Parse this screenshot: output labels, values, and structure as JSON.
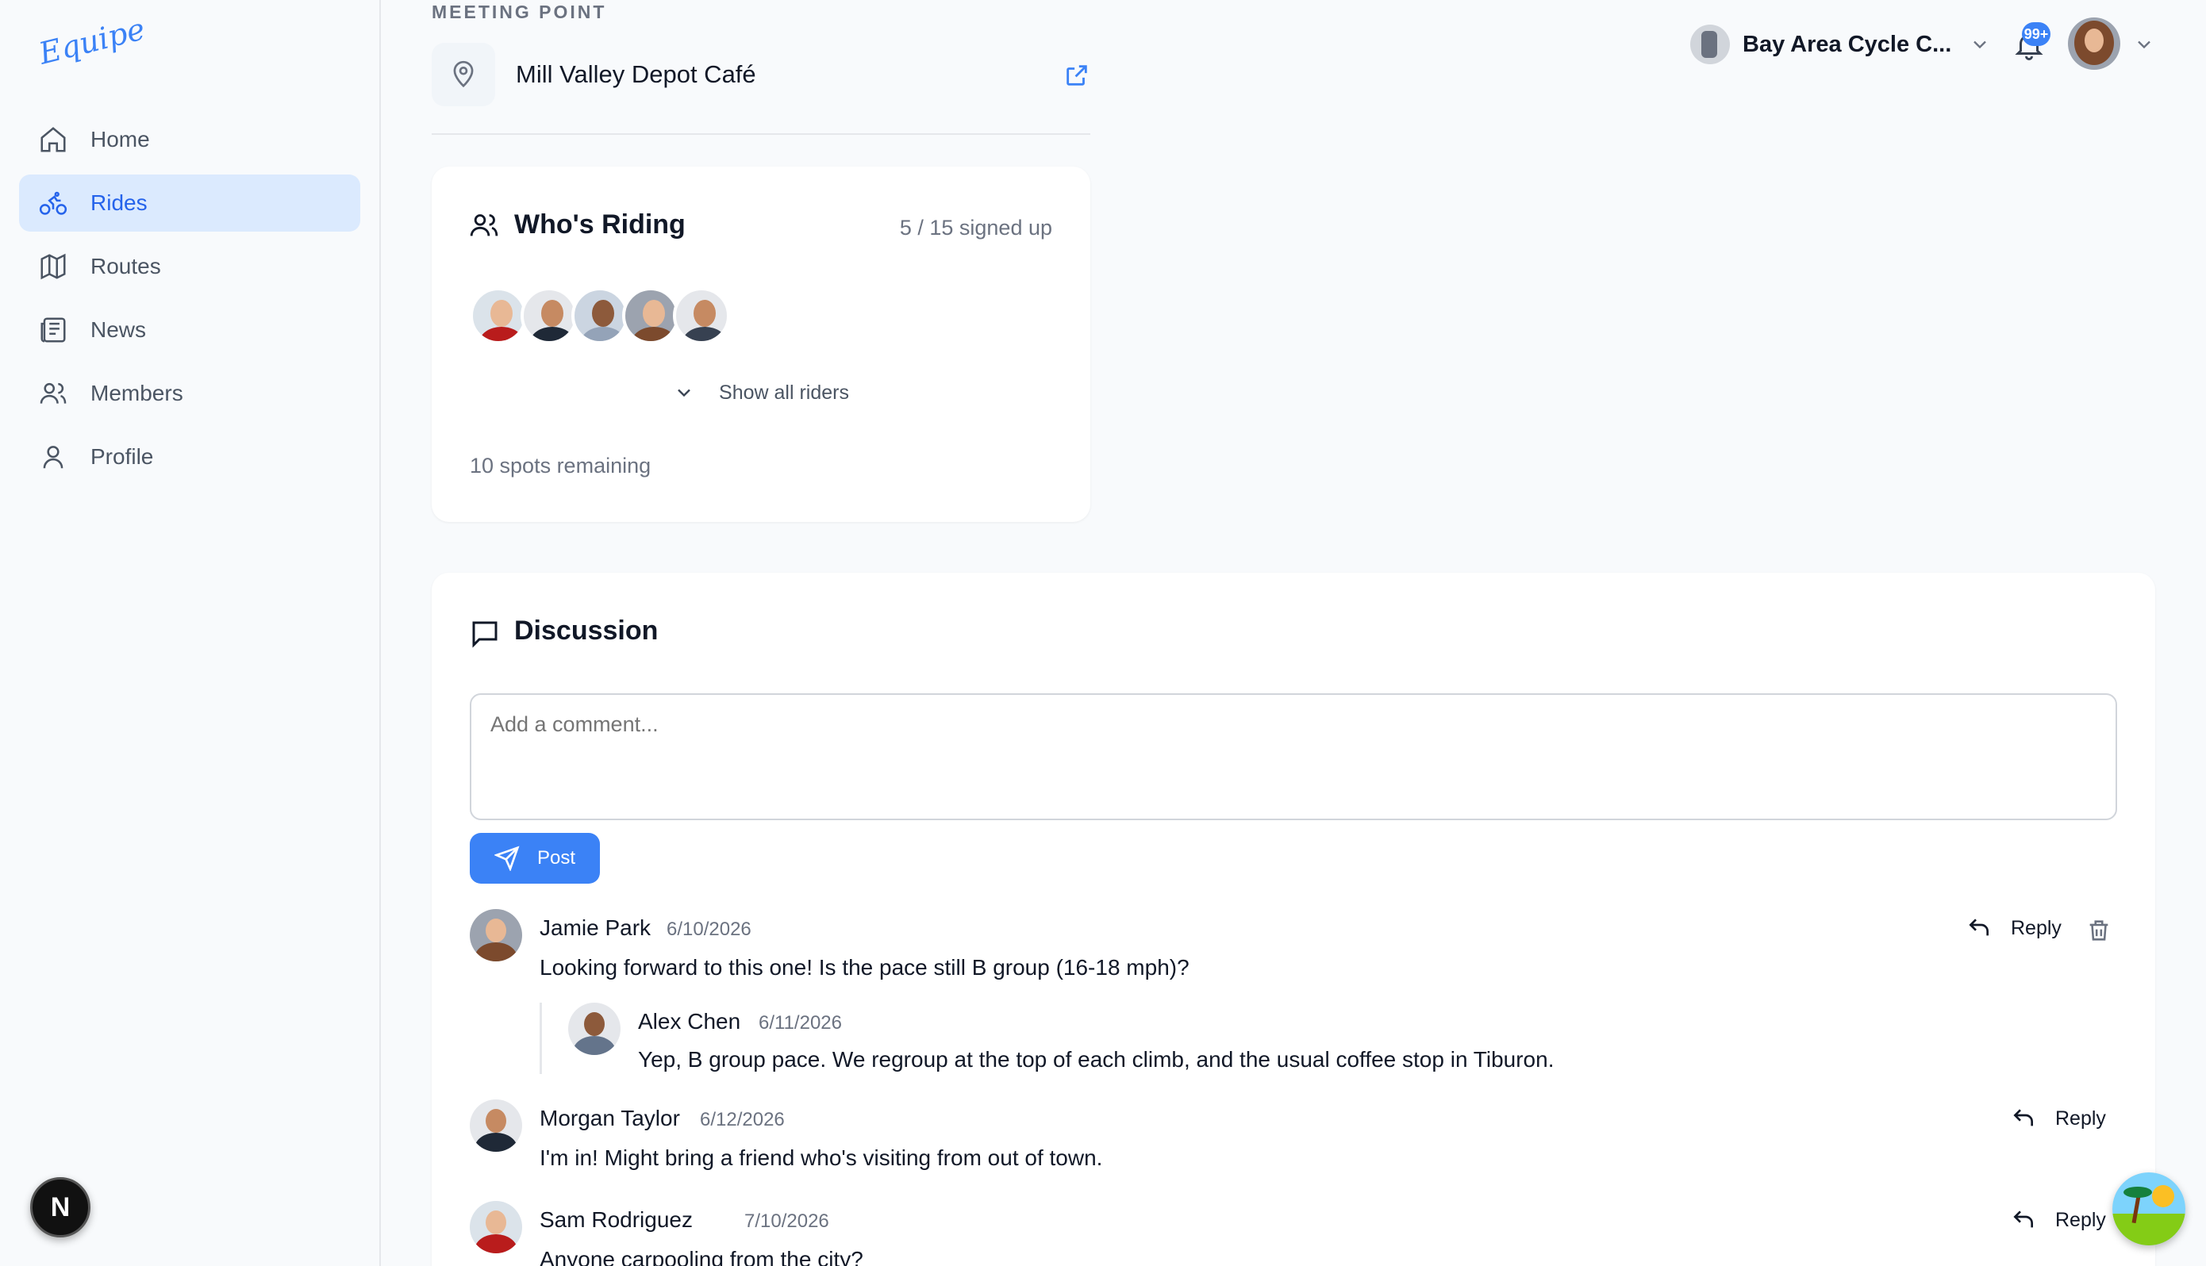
{
  "app": {
    "logo_text": "Equipe"
  },
  "sidebar": {
    "items": [
      {
        "label": "Home",
        "icon": "home-icon",
        "active": false
      },
      {
        "label": "Rides",
        "icon": "bike-icon",
        "active": true
      },
      {
        "label": "Routes",
        "icon": "map-icon",
        "active": false
      },
      {
        "label": "News",
        "icon": "newspaper-icon",
        "active": false
      },
      {
        "label": "Members",
        "icon": "users-icon",
        "active": false
      },
      {
        "label": "Profile",
        "icon": "user-icon",
        "active": false
      }
    ],
    "dev_badge": "N"
  },
  "topbar": {
    "club_name": "Bay Area Cycle C...",
    "notification_count": "99+"
  },
  "meeting": {
    "label": "MEETING POINT",
    "name": "Mill Valley Depot Café"
  },
  "riders": {
    "title": "Who's Riding",
    "count_text": "5 / 15 signed up",
    "show_all_label": "Show all riders",
    "spots_remaining": "10 spots remaining"
  },
  "discussion": {
    "title": "Discussion",
    "comment_placeholder": "Add a comment...",
    "post_label": "Post",
    "reply_label": "Reply",
    "comments": [
      {
        "author": "Jamie Park",
        "date": "6/10/2026",
        "text": "Looking forward to this one! Is the pace still B group (16-18 mph)?"
      },
      {
        "author": "Alex Chen",
        "date": "6/11/2026",
        "text": "Yep, B group pace. We regroup at the top of each climb, and the usual coffee stop in Tiburon."
      },
      {
        "author": "Morgan Taylor",
        "date": "6/12/2026",
        "text": "I'm in! Might bring a friend who's visiting from out of town."
      },
      {
        "author": "Sam Rodriguez",
        "date": "7/10/2026",
        "text": "Anyone carpooling from the city?"
      }
    ]
  },
  "colors": {
    "accent": "#3b82f6",
    "active_bg": "#dbeafe",
    "page_bg": "#f8fafc"
  }
}
